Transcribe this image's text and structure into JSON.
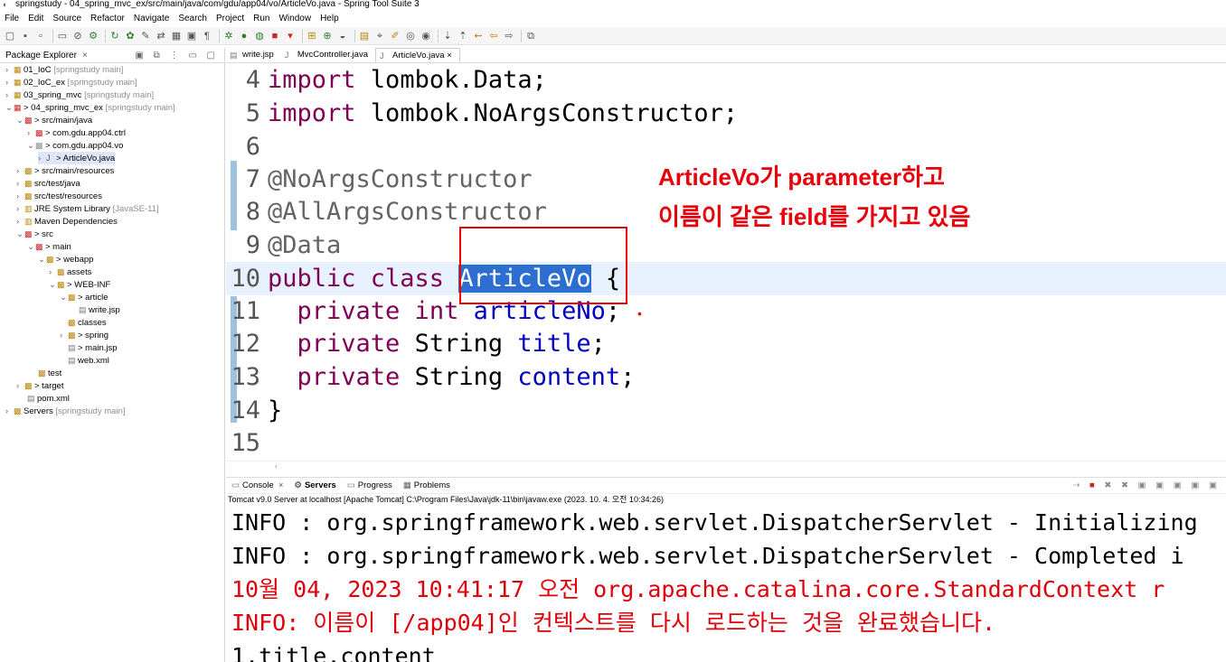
{
  "window": {
    "title": "springstudy - 04_spring_mvc_ex/src/main/java/com/gdu/app04/vo/ArticleVo.java - Spring Tool Suite 3"
  },
  "menu": [
    "File",
    "Edit",
    "Source",
    "Refactor",
    "Navigate",
    "Search",
    "Project",
    "Run",
    "Window",
    "Help"
  ],
  "package_explorer": {
    "title": "Package Explorer",
    "items": [
      {
        "label": "01_IoC",
        "decor": "[springstudy main]"
      },
      {
        "label": "02_IoC_ex",
        "decor": "[springstudy main]"
      },
      {
        "label": "03_spring_mvc",
        "decor": "[springstudy main]"
      },
      {
        "label": "> 04_spring_mvc_ex",
        "decor": "[springstudy main]"
      },
      {
        "label": "> src/main/java",
        "decor": ""
      },
      {
        "label": "> com.gdu.app04.ctrl",
        "decor": ""
      },
      {
        "label": "> com.gdu.app04.vo",
        "decor": ""
      },
      {
        "label": "> ArticleVo.java",
        "decor": ""
      },
      {
        "label": "> src/main/resources",
        "decor": ""
      },
      {
        "label": "src/test/java",
        "decor": ""
      },
      {
        "label": "src/test/resources",
        "decor": ""
      },
      {
        "label": "JRE System Library",
        "decor": "[JavaSE-11]"
      },
      {
        "label": "Maven Dependencies",
        "decor": ""
      },
      {
        "label": "> src",
        "decor": ""
      },
      {
        "label": "> main",
        "decor": ""
      },
      {
        "label": "> webapp",
        "decor": ""
      },
      {
        "label": "assets",
        "decor": ""
      },
      {
        "label": "> WEB-INF",
        "decor": ""
      },
      {
        "label": "> article",
        "decor": ""
      },
      {
        "label": "write.jsp",
        "decor": ""
      },
      {
        "label": "classes",
        "decor": ""
      },
      {
        "label": "> spring",
        "decor": ""
      },
      {
        "label": "> main.jsp",
        "decor": ""
      },
      {
        "label": "web.xml",
        "decor": ""
      },
      {
        "label": "test",
        "decor": ""
      },
      {
        "label": "> target",
        "decor": ""
      },
      {
        "label": "pom.xml",
        "decor": ""
      },
      {
        "label": "Servers",
        "decor": "[springstudy main]"
      }
    ]
  },
  "editor_tabs": [
    {
      "label": "write.jsp"
    },
    {
      "label": "MvcController.java"
    },
    {
      "label": "ArticleVo.java",
      "close": "×"
    }
  ],
  "code": {
    "line_numbers": [
      "4",
      "5",
      "6",
      "7",
      "8",
      "9",
      "10",
      "11",
      "12",
      "13",
      "14",
      "15"
    ],
    "l4": {
      "kw": "import",
      "rest": " lombok.Data;"
    },
    "l5": {
      "kw": "import",
      "rest": " lombok.NoArgsConstructor;"
    },
    "l7": "@NoArgsConstructor",
    "l8": "@AllArgsConstructor",
    "l9": "@Data",
    "l10": {
      "kw": "public class",
      "name": "ArticleVo",
      "rest": " {"
    },
    "l11": {
      "kw": "private int",
      "field": "articleNo",
      "rest": ";"
    },
    "l12": {
      "kw": "private",
      "type": " String",
      "field": "title",
      "rest": ";"
    },
    "l13": {
      "kw": "private",
      "type": " String",
      "field": "content",
      "rest": ";"
    },
    "l14": "}"
  },
  "annotation": {
    "line1": "ArticleVo가 parameter하고",
    "line2": "이름이 같은 field를 가지고 있음"
  },
  "console": {
    "tabs": [
      "Console",
      "Servers",
      "Progress",
      "Problems"
    ],
    "description": "Tomcat v9.0 Server at localhost [Apache Tomcat] C:\\Program Files\\Java\\jdk-11\\bin\\javaw.exe  (2023. 10. 4. 오전 10:34:26)",
    "lines": [
      "INFO : org.springframework.web.servlet.DispatcherServlet - Initializing",
      "INFO : org.springframework.web.servlet.DispatcherServlet - Completed i",
      "10월 04, 2023 10:41:17 오전 org.apache.catalina.core.StandardContext r",
      "INFO: 이름이 [/app04]인 컨텍스트를 다시 로드하는 것을 완료했습니다.",
      "1,title,content"
    ]
  },
  "colors": {
    "keyword": "#7f0055",
    "annotation_text": "#e8000b",
    "selection": "#2d6fd1"
  }
}
